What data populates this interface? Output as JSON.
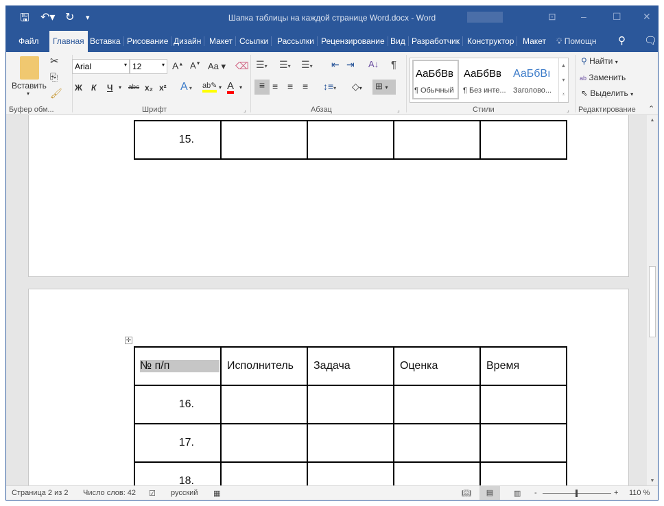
{
  "window": {
    "title": "Шапка таблицы на каждой странице Word.docx  -  Word",
    "accent": "#2b579a"
  },
  "quick_access": {
    "save_icon": "save-icon",
    "undo_icon": "undo-icon",
    "redo_icon": "redo-icon",
    "customize_icon": "chevron-down-icon"
  },
  "tabs": [
    "Файл",
    "Главная",
    "Вставка",
    "Рисование",
    "Дизайн",
    "Макет",
    "Ссылки",
    "Рассылки",
    "Рецензирование",
    "Вид",
    "Разработчик",
    "Конструктор",
    "Макет"
  ],
  "tell_me": "Помощн",
  "ribbon": {
    "clipboard": {
      "paste": "Вставить",
      "label": "Буфер обм..."
    },
    "font": {
      "name": "Arial",
      "size": "12",
      "label": "Шрифт",
      "bold": "Ж",
      "italic": "К",
      "underline": "Ч",
      "strike": "abc",
      "sub": "x₂",
      "sup": "x²",
      "case": "Aa",
      "grow": "A",
      "shrink": "A",
      "effects": "A",
      "color": "A",
      "highlight_color": "#ffff00",
      "font_color": "#ff0000"
    },
    "paragraph": {
      "label": "Абзац",
      "pilcrow": "¶"
    },
    "styles": {
      "label": "Стили",
      "items": [
        {
          "preview": "АаБбВв",
          "name": "¶ Обычный"
        },
        {
          "preview": "АаБбВв",
          "name": "¶ Без инте..."
        },
        {
          "preview": "АаБбВı",
          "name": "Заголово..."
        }
      ]
    },
    "editing": {
      "label": "Редактирование",
      "find": "Найти",
      "replace": "Заменить",
      "select": "Выделить"
    }
  },
  "document": {
    "page1_rows": [
      [
        "15.",
        "",
        "",
        "",
        ""
      ]
    ],
    "header": [
      "№ п/п",
      "Исполнитель",
      "Задача",
      "Оценка",
      "Время"
    ],
    "page2_rows": [
      [
        "16.",
        "",
        "",
        "",
        ""
      ],
      [
        "17.",
        "",
        "",
        "",
        ""
      ],
      [
        "18.",
        "",
        "",
        "",
        ""
      ]
    ]
  },
  "status": {
    "page": "Страница 2 из 2",
    "words": "Число слов: 42",
    "language": "русский",
    "zoom": "110 %",
    "zoom_value_percent": 110
  }
}
